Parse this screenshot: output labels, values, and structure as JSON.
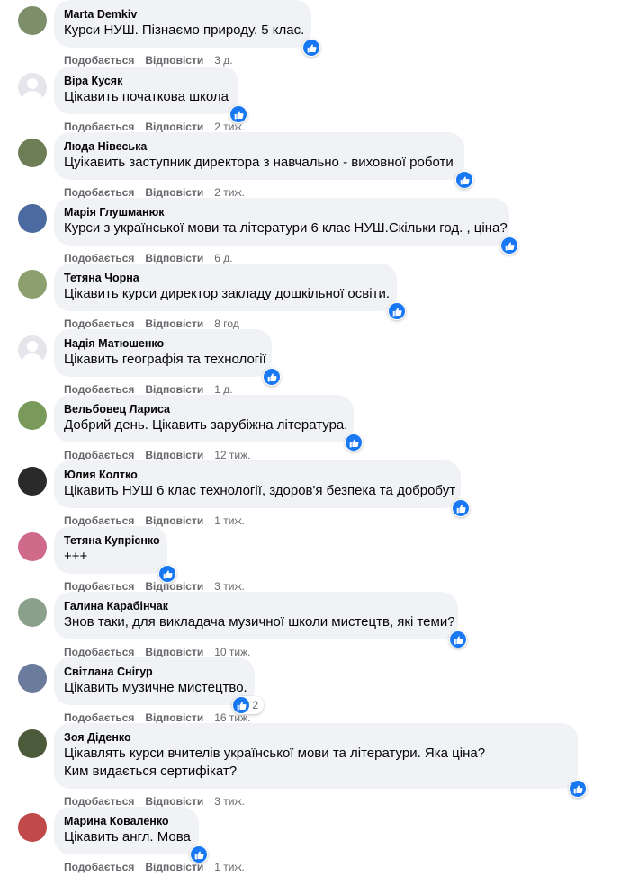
{
  "comments": [
    {
      "author": "Marta Demkiv",
      "text": "Курси НУШ. Пізнаємо природу. 5 клас.",
      "like": "Подобається",
      "reply": "Відповісти",
      "time": "3 д."
    },
    {
      "author": "Віра Кусяк",
      "text": "Цікавить початкова школа",
      "like": "Подобається",
      "reply": "Відповісти",
      "time": "2 тиж."
    },
    {
      "author": "Люда Нівеська",
      "text": "Цуікавить заступник директора з навчально - виховної роботи",
      "like": "Подобається",
      "reply": "Відповісти",
      "time": "2 тиж."
    },
    {
      "author": "Марія Глушманюк",
      "text": "Курси з української мови та літератури 6 клас НУШ.Скільки год. , ціна?",
      "like": "Подобається",
      "reply": "Відповісти",
      "time": "6 д."
    },
    {
      "author": "Тетяна Чорна",
      "text": "Цікавить курси директор закладу дошкільної освіти.",
      "like": "Подобається",
      "reply": "Відповісти",
      "time": "8 год"
    },
    {
      "author": "Надія Матюшенко",
      "text": "Цікавить географія та технології",
      "like": "Подобається",
      "reply": "Відповісти",
      "time": "1 д."
    },
    {
      "author": "Вельбовец Лариса",
      "text": "Добрий день. Цікавить зарубіжна література.",
      "like": "Подобається",
      "reply": "Відповісти",
      "time": "12 тиж."
    },
    {
      "author": "Юлия Колтко",
      "text": "Цікавить НУШ 6 клас технології, здоров'я безпека та добробут",
      "like": "Подобається",
      "reply": "Відповісти",
      "time": "1 тиж."
    },
    {
      "author": "Тетяна Купрієнко",
      "text": "+++",
      "like": "Подобається",
      "reply": "Відповісти",
      "time": "3 тиж."
    },
    {
      "author": "Галина Карабінчак",
      "text": "Знов таки, для викладача музичної школи мистецтв, які теми?",
      "like": "Подобається",
      "reply": "Відповісти",
      "time": "10 тиж."
    },
    {
      "author": "Світлана Снігур",
      "text": "Цікавить музичне мистецтво.",
      "like_count": "2",
      "like": "Подобається",
      "reply": "Відповісти",
      "time": "16 тиж."
    },
    {
      "author": "Зоя Діденко",
      "text": "Цікавлять курси вчителів української мови та літератури. Яка ціна? Ким видається сертифікат?",
      "like": "Подобається",
      "reply": "Відповісти",
      "time": "3 тиж."
    },
    {
      "author": "Марина Коваленко",
      "text": "Цікавить англ. Мова",
      "like": "Подобається",
      "reply": "Відповісти",
      "time": "1 тиж."
    }
  ],
  "colors": {
    "like_blue": "#1877f2",
    "bubble": "#f0f2f5",
    "meta_gray": "#65676b"
  },
  "icons": {
    "reaction": "thumbs-up-icon"
  }
}
